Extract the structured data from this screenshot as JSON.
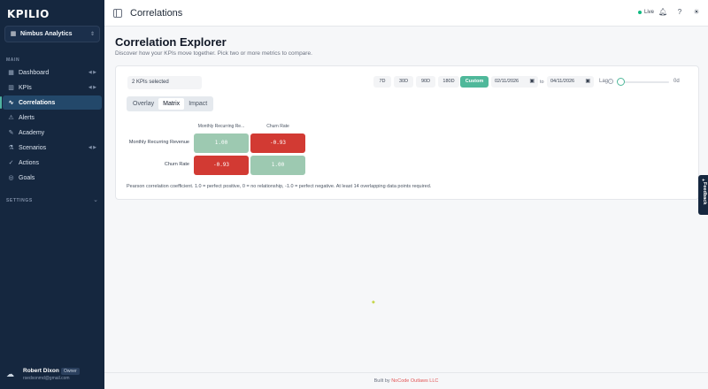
{
  "app": {
    "logo_text": "KPILIO",
    "page_title": "Correlations"
  },
  "workspace": {
    "name": "Nimbus Analytics",
    "icon": "building-icon"
  },
  "sidebar": {
    "main_label": "MAIN",
    "settings_label": "SETTINGS",
    "items": [
      {
        "label": "Dashboard",
        "icon": "dashboard-icon",
        "arrow": "◀ ▶"
      },
      {
        "label": "KPIs",
        "icon": "chart-icon",
        "arrow": "◀ ▶"
      },
      {
        "label": "Correlations",
        "icon": "correlation-icon",
        "active": true
      },
      {
        "label": "Alerts",
        "icon": "alert-icon"
      },
      {
        "label": "Academy",
        "icon": "academy-icon"
      },
      {
        "label": "Scenarios",
        "icon": "scenarios-icon",
        "arrow": "◀ ▶"
      },
      {
        "label": "Actions",
        "icon": "actions-icon"
      },
      {
        "label": "Goals",
        "icon": "goals-icon"
      }
    ]
  },
  "user": {
    "name": "Robert Dixon",
    "role": "Owner",
    "email": "rsedxonmd@gmail.com"
  },
  "topbar": {
    "live_label": "Live"
  },
  "main": {
    "title": "Correlation Explorer",
    "subtitle": "Discover how your KPIs move together. Pick two or more metrics to compare."
  },
  "controls": {
    "kpi_select": "2 KPIs selected",
    "ranges": [
      "7D",
      "30D",
      "90D",
      "180D",
      "Custom"
    ],
    "active_range": "Custom",
    "date_from": "02/11/2026",
    "to_label": "to",
    "date_to": "04/11/2026",
    "lag_label": "Lag",
    "lag_value": "0d",
    "lag_fraction": 0
  },
  "tabs": [
    "Overlay",
    "Matrix",
    "Impact"
  ],
  "active_tab": "Matrix",
  "matrix": {
    "columns": [
      "Monthly Recurring Re...",
      "Churn Rate"
    ],
    "rows": [
      "Monthly Recurring Revenue",
      "Churn Rate"
    ],
    "values": [
      [
        "1.00",
        "-0.93"
      ],
      [
        "-0.93",
        "1.00"
      ]
    ]
  },
  "footnote": "Pearson correlation coefficient. 1.0 = perfect positive, 0 = no relationship, -1.0 = perfect negative. At least 14 overlapping data points required.",
  "feedback_label": "Feedback",
  "feedback_icon": "plus-icon",
  "footer": {
    "prefix": "Built by",
    "brand": "NoCode Outlaws LLC"
  },
  "colors": {
    "sidebar": "#15273f",
    "accent": "#4fb89a",
    "negative": "#d23a33",
    "positive": "#9dc9b1"
  }
}
